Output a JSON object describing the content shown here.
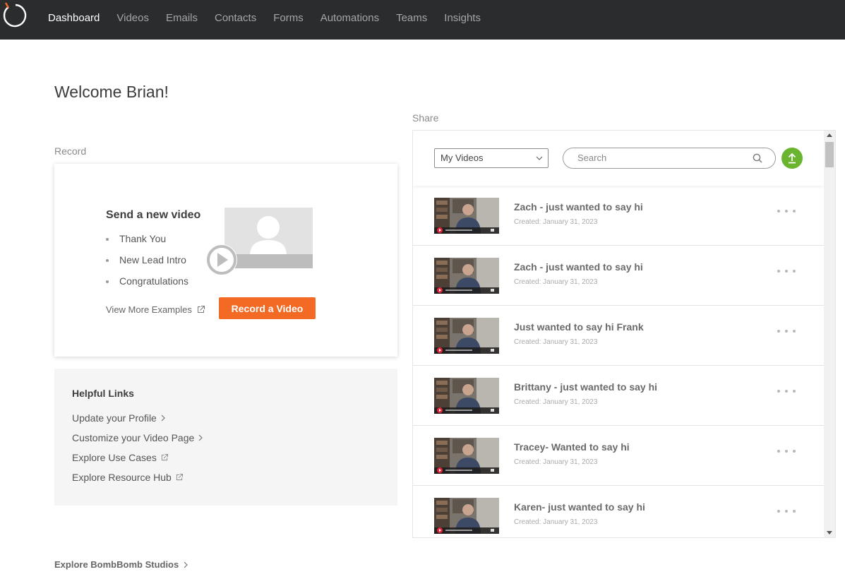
{
  "nav": {
    "items": [
      {
        "label": "Dashboard",
        "active": true
      },
      {
        "label": "Videos",
        "active": false
      },
      {
        "label": "Emails",
        "active": false
      },
      {
        "label": "Contacts",
        "active": false
      },
      {
        "label": "Forms",
        "active": false
      },
      {
        "label": "Automations",
        "active": false
      },
      {
        "label": "Teams",
        "active": false
      },
      {
        "label": "Insights",
        "active": false
      }
    ]
  },
  "welcome": "Welcome Brian!",
  "record": {
    "section_label": "Record",
    "card_title": "Send a new video",
    "examples": [
      "Thank You",
      "New Lead Intro",
      "Congratulations"
    ],
    "view_more": "View More Examples",
    "record_button": "Record a Video"
  },
  "helpful": {
    "title": "Helpful Links",
    "links": [
      {
        "label": "Update your Profile",
        "icon": "chevron-right-icon"
      },
      {
        "label": "Customize your Video Page",
        "icon": "chevron-right-icon"
      },
      {
        "label": "Explore Use Cases",
        "icon": "external-link-icon"
      },
      {
        "label": "Explore Resource Hub",
        "icon": "external-link-icon"
      }
    ]
  },
  "studios_link": "Explore BombBomb Studios",
  "share": {
    "section_label": "Share",
    "filter_selected": "My Videos",
    "search_placeholder": "Search",
    "videos": [
      {
        "title": "Zach - just wanted to say hi",
        "created": "Created: January 31, 2023"
      },
      {
        "title": "Zach - just wanted to say hi",
        "created": "Created: January 31, 2023"
      },
      {
        "title": "Just wanted to say hi Frank",
        "created": "Created: January 31, 2023"
      },
      {
        "title": "Brittany - just wanted to say hi",
        "created": "Created: January 31, 2023"
      },
      {
        "title": "Tracey- Wanted to say hi",
        "created": "Created: January 31, 2023"
      },
      {
        "title": "Karen- just wanted to say hi",
        "created": "Created: January 31, 2023"
      }
    ]
  },
  "colors": {
    "nav_bg": "#2b2c2e",
    "record_button": "#f26a23",
    "upload_button": "#6ab42f"
  }
}
